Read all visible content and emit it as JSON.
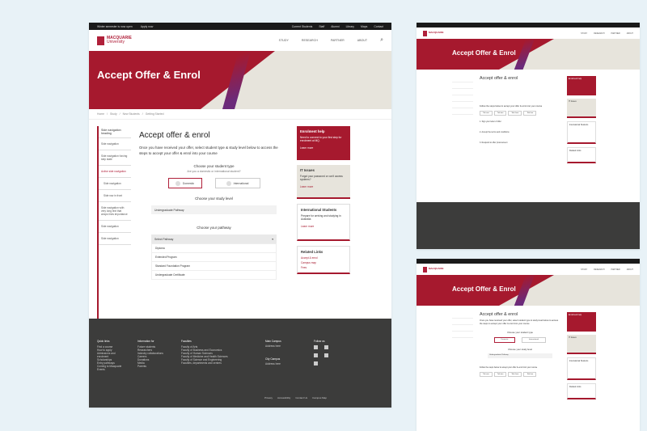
{
  "brand": {
    "line1": "MACQUARIE",
    "line2": "University",
    "accent": "#a6192e",
    "footer_bg": "#3c3c3b"
  },
  "topbar": {
    "left": [
      "Winter semester is now open",
      "Apply now"
    ],
    "right": [
      "Current Students",
      "Staff",
      "Alumni",
      "Library",
      "Maps",
      "Contact"
    ]
  },
  "nav": [
    "STUDY",
    "RESEARCH",
    "PARTNER",
    "ABOUT"
  ],
  "hero": {
    "title": "Accept Offer & Enrol"
  },
  "breadcrumb": [
    "Home",
    "Study",
    "New Students",
    "Getting Started"
  ],
  "sidenav": [
    {
      "label": "Side navigation heading",
      "state": "heading"
    },
    {
      "label": "Side navigation"
    },
    {
      "label": "Side navigation forcing step state"
    },
    {
      "label": "Active side navigation",
      "state": "active"
    },
    {
      "label": "Side navigation"
    },
    {
      "label": "Side nav in front"
    },
    {
      "label": "Side navigation with very long text that wraps lines importance"
    },
    {
      "label": "Side navigation"
    },
    {
      "label": "Side navigation"
    }
  ],
  "main": {
    "title": "Accept offer & enrol",
    "intro": "Once you have received your offer, select student type & study level below to access the steps to accept your offer & enrol into your course",
    "student_type_heading": "Choose your student type",
    "student_type_question": "Are you a domestic or international student?",
    "student_type_options": [
      "Domestic",
      "International"
    ],
    "study_level_heading": "Choose your study level",
    "study_level_value": "Undergraduate Pathway",
    "pathway_heading": "Choose your pathway",
    "pathway_select": "Select Pathway",
    "pathway_options": [
      "Diploma",
      "Extended Program",
      "Standard Foundation Program",
      "Undergraduate Certificate"
    ]
  },
  "cards": [
    {
      "title": "Enrolment help",
      "body": "Need to connect to your first step for enrolment at MQ.",
      "link": "Learn more",
      "style": "red"
    },
    {
      "title": "IT Issues",
      "body": "Forgot your password or can't access systems?",
      "link": "Learn more",
      "style": "beige"
    },
    {
      "title": "International Students",
      "body": "Prepare for arriving and studying in Australia",
      "link": "Learn more",
      "style": "white"
    }
  ],
  "related": {
    "title": "Related Links",
    "links": [
      "Accept & enrol",
      "Campus map",
      "Fees"
    ]
  },
  "footer": {
    "columns": [
      {
        "title": "Quick links",
        "items": [
          "Find a course",
          "How to apply",
          "Admissions and enrolment",
          "Scholarships",
          "Entry pathways",
          "Coming to Macquarie",
          "Events"
        ]
      },
      {
        "title": "Information for",
        "items": [
          "Future students",
          "Researchers",
          "Industry collaborations",
          "Careers",
          "Donations",
          "Media",
          "Parents"
        ]
      },
      {
        "title": "Faculties",
        "items": [
          "Faculty of Arts",
          "Faculty of Business and Economics",
          "Faculty of Human Sciences",
          "Faculty of Medicine and Health Sciences",
          "Faculty of Science and Engineering",
          "Faculties, departments and centres"
        ]
      }
    ],
    "campus1_title": "Main Campus",
    "campus1_line": "Address here",
    "campus2_title": "City Campus",
    "campus2_line": "Address here",
    "follow_title": "Follow us",
    "bottom_links": [
      "Privacy",
      "Accessibility",
      "Contact Us",
      "Campus Map"
    ]
  },
  "frame_b": {
    "tabs": [
      "Tab one",
      "Tab two",
      "Tab three",
      "Tab four"
    ],
    "step_intro": "Follow the steps below to accept your offer & enrol into your course",
    "steps": [
      "1. Sign your letter of offer",
      "2. Accept the terms and conditions",
      "3. Respond to offer procurement"
    ]
  }
}
